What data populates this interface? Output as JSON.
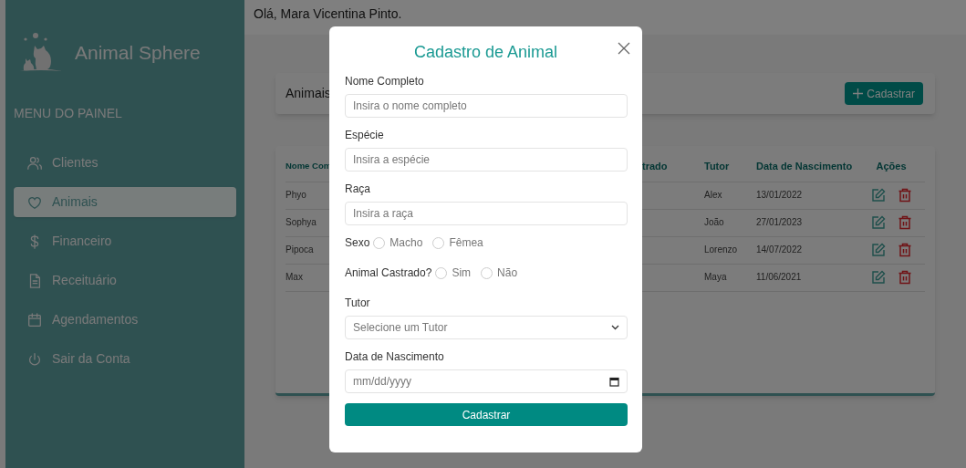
{
  "sidebar": {
    "brand": "Animal Sphere",
    "menu_title": "MENU DO PAINEL",
    "items": [
      {
        "label": "Clientes",
        "selected": false
      },
      {
        "label": "Animais",
        "selected": true
      },
      {
        "label": "Financeiro",
        "selected": false
      },
      {
        "label": "Receituário",
        "selected": false
      },
      {
        "label": "Agendamentos",
        "selected": false
      },
      {
        "label": "Sair da Conta",
        "selected": false
      }
    ]
  },
  "header": {
    "greeting": "Olá, Mara Vicentina Pinto."
  },
  "page": {
    "title": "Animais",
    "add_button": "Cadastrar"
  },
  "table": {
    "columns": [
      "Nome Com",
      "trado",
      "Tutor",
      "Data de Nascimento",
      "Ações"
    ],
    "rows": [
      {
        "name": "Phyo",
        "tutor": "Alex",
        "birth_date": "13/01/2022"
      },
      {
        "name": "Sophya",
        "tutor": "João",
        "birth_date": "27/01/2023"
      },
      {
        "name": "Pipoca",
        "tutor": "Lorenzo",
        "birth_date": "14/07/2022"
      },
      {
        "name": "Max",
        "tutor": "Maya",
        "birth_date": "11/06/2021"
      }
    ]
  },
  "modal": {
    "title": "Cadastro de Animal",
    "fields": [
      {
        "kind": "text",
        "label": "Nome Completo",
        "placeholder": "Insira o nome completo"
      },
      {
        "kind": "text",
        "label": "Espécie",
        "placeholder": "Insira a espécie"
      },
      {
        "kind": "text",
        "label": "Raça",
        "placeholder": "Insira a raça"
      },
      {
        "kind": "radio",
        "label": "Sexo",
        "options": [
          {
            "label": "Macho",
            "checked": false
          },
          {
            "label": "Fêmea",
            "checked": false
          }
        ]
      },
      {
        "kind": "radio",
        "label": "Animal Castrado?",
        "options": [
          {
            "label": "Sim",
            "checked": false
          },
          {
            "label": "Não",
            "checked": false
          }
        ]
      },
      {
        "kind": "select",
        "label": "Tutor",
        "placeholder": "Selecione um Tutor"
      },
      {
        "kind": "date",
        "label": "Data de Nascimento",
        "placeholder": "mm/dd/yyyy"
      }
    ],
    "submit": "Cadastrar"
  }
}
